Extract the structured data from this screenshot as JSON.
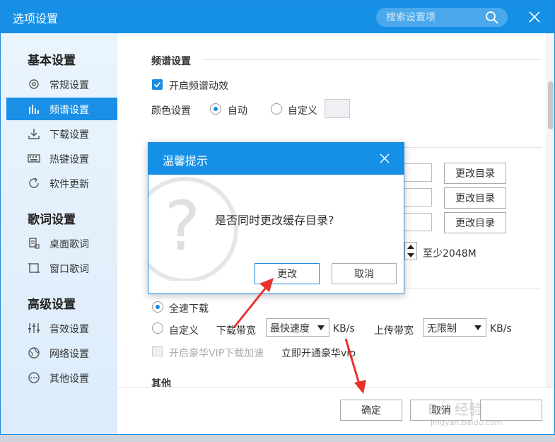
{
  "window": {
    "title": "选项设置",
    "search_placeholder": "搜索设置项"
  },
  "sidebar": {
    "groups": [
      {
        "title": "基本设置",
        "items": [
          "常规设置",
          "频谱设置",
          "下载设置",
          "热键设置",
          "软件更新"
        ]
      },
      {
        "title": "歌词设置",
        "items": [
          "桌面歌词",
          "窗口歌词"
        ]
      },
      {
        "title": "高级设置",
        "items": [
          "音效设置",
          "网络设置",
          "其他设置"
        ]
      }
    ],
    "active_item": "频谱设置"
  },
  "spectrum": {
    "section_title": "频谱设置",
    "enable_effect_label": "开启频谱动效",
    "enable_effect_checked": true,
    "color_label": "颜色设置",
    "color_auto_label": "自动",
    "color_custom_label": "自定义",
    "color_selected": "auto"
  },
  "download_dirs": {
    "change_dir_label": "更改目录",
    "min_space_label": "至少2048M"
  },
  "speed": {
    "full_speed_label": "全速下载",
    "custom_label": "自定义",
    "selected": "full",
    "download_bandwidth_label": "下载带宽",
    "download_bandwidth_value": "最快速度",
    "download_unit": "KB/s",
    "upload_bandwidth_label": "上传带宽",
    "upload_bandwidth_value": "无限制",
    "upload_unit": "KB/s",
    "vip_accel_label": "开启豪华VIP下载加速",
    "vip_accel_checked": false,
    "vip_link_label": "立即开通豪华vip"
  },
  "other": {
    "section_title": "其他"
  },
  "footer": {
    "ok_label": "确定",
    "cancel_label": "取消"
  },
  "dialog": {
    "title": "温馨提示",
    "message": "是否同时更改缓存目录?",
    "confirm_label": "更改",
    "cancel_label": "取消"
  },
  "watermark": {
    "brand": "Bai 经验",
    "url": "jingyan.baidu.com"
  },
  "colors": {
    "accent": "#1590e6",
    "annotation_arrow": "#e8322a"
  }
}
